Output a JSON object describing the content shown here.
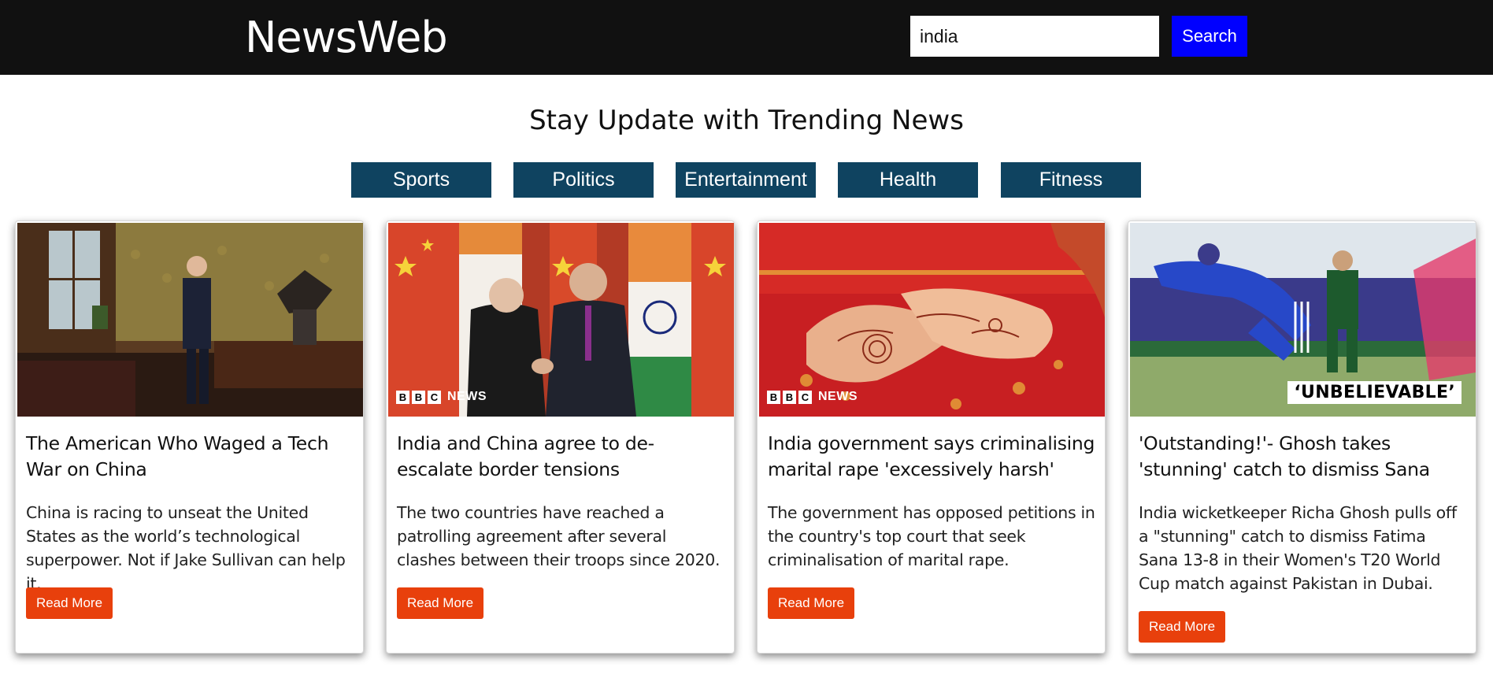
{
  "header": {
    "logo": "NewsWeb",
    "search_value": "india",
    "search_button": "Search"
  },
  "headline": "Stay Update with Trending News",
  "categories": [
    "Sports",
    "Politics",
    "Entertainment",
    "Health",
    "Fitness"
  ],
  "cards": [
    {
      "title": "The American Who Waged a Tech War on China",
      "description": "China is racing to unseat the United States as the world’s technological superpower. Not if Jake Sullivan can help it.",
      "button": "Read More"
    },
    {
      "title": "India and China agree to de-escalate border tensions",
      "description": "The two countries have reached a patrolling agreement after several clashes between their troops since 2020.",
      "button": "Read More",
      "badge": {
        "letters": [
          "B",
          "B",
          "C"
        ],
        "text": "NEWS"
      }
    },
    {
      "title": "India government says criminalising marital rape 'excessively harsh'",
      "description": "The government has opposed petitions in the country's top court that seek criminalisation of marital rape.",
      "button": "Read More",
      "badge": {
        "letters": [
          "B",
          "B",
          "C"
        ],
        "text": "NEWS"
      }
    },
    {
      "title": "'Outstanding!'- Ghosh takes 'stunning' catch to dismiss Sana",
      "description": "India wicketkeeper Richa Ghosh pulls off a \"stunning\" catch to dismiss Fatima Sana 13-8 in their Women's T20 World Cup match against Pakistan in Dubai.",
      "button": "Read More",
      "overlay": "‘UNBELIEVABLE’"
    }
  ],
  "colors": {
    "header_bg": "#111111",
    "search_button": "#0000ff",
    "category_button": "#0f4360",
    "read_more": "#e8400c"
  }
}
